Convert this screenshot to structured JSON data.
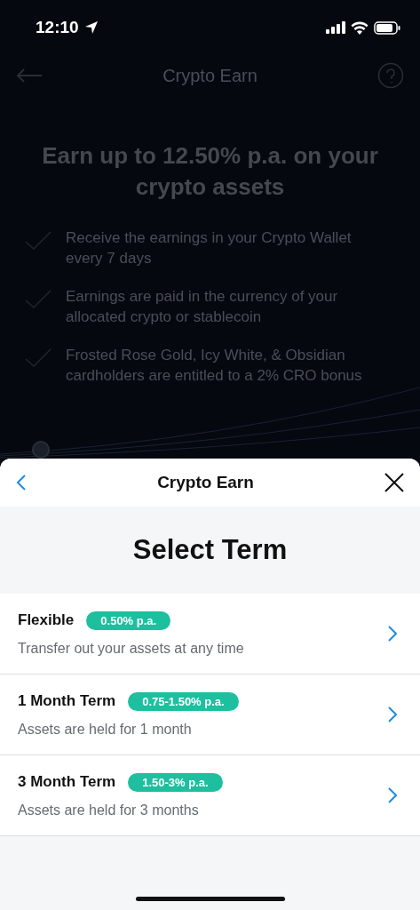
{
  "status_bar": {
    "time": "12:10"
  },
  "background": {
    "header": {
      "title": "Crypto Earn"
    },
    "headline": "Earn up to 12.50% p.a. on your crypto assets",
    "benefits": [
      "Receive the earnings in your Crypto Wallet every 7 days",
      "Earnings are paid in the currency of your allocated crypto or stablecoin",
      "Frosted Rose Gold, Icy White, & Obsidian cardholders are entitled to a 2% CRO bonus"
    ]
  },
  "sheet": {
    "title": "Crypto Earn",
    "heading": "Select Term",
    "terms": [
      {
        "name": "Flexible",
        "rate": "0.50% p.a.",
        "description": "Transfer out your assets at any time"
      },
      {
        "name": "1 Month Term",
        "rate": "0.75-1.50% p.a.",
        "description": "Assets are held for 1 month"
      },
      {
        "name": "3 Month Term",
        "rate": "1.50-3% p.a.",
        "description": "Assets are held for 3 months"
      }
    ]
  }
}
